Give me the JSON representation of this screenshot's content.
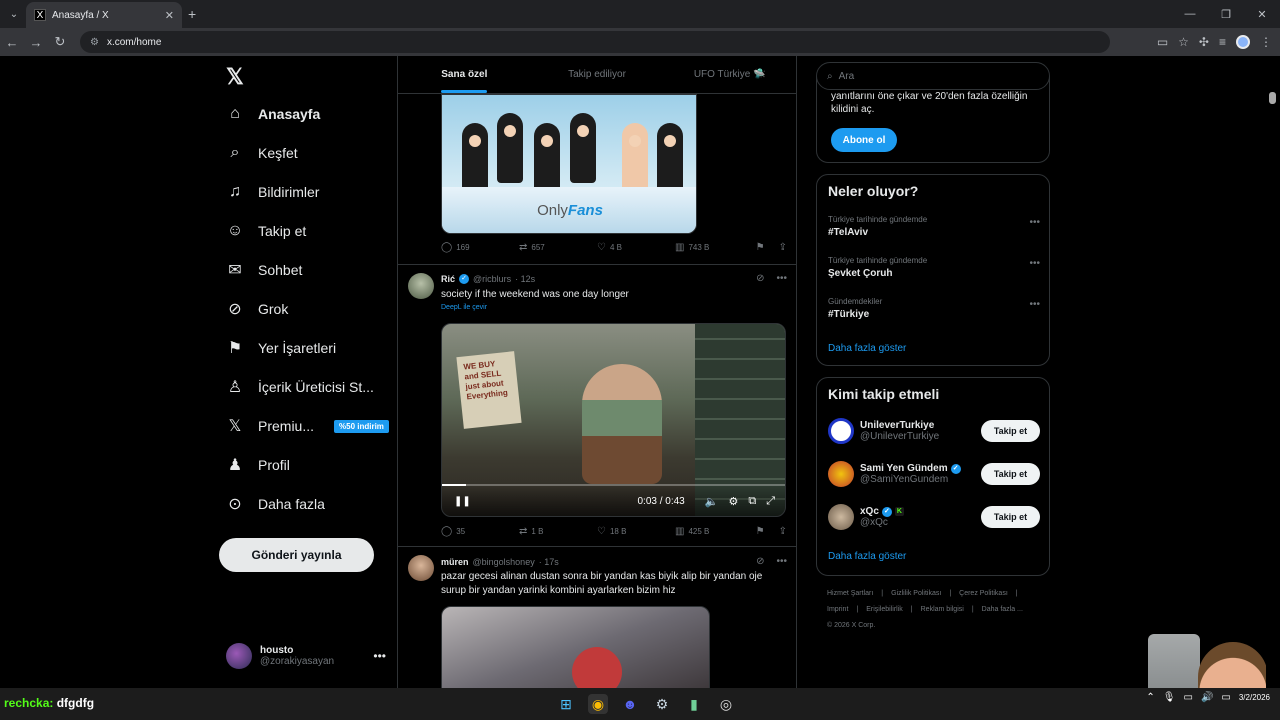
{
  "browser": {
    "tab_title": "Anasayfa / X",
    "tab_favicon": "X",
    "url": "x.com/home"
  },
  "nav": {
    "logo": "𝕏",
    "items": [
      {
        "label": "Anasayfa",
        "icon": "⌂"
      },
      {
        "label": "Keşfet",
        "icon": "⌕"
      },
      {
        "label": "Bildirimler",
        "icon": "♫"
      },
      {
        "label": "Takip et",
        "icon": "☺"
      },
      {
        "label": "Sohbet",
        "icon": "✉"
      },
      {
        "label": "Grok",
        "icon": "⊘"
      },
      {
        "label": "Yer İşaretleri",
        "icon": "⚑"
      },
      {
        "label": "İçerik Üreticisi St...",
        "icon": "♙"
      },
      {
        "label": "Premiu...",
        "icon": "𝕏"
      },
      {
        "label": "Profil",
        "icon": "♟"
      },
      {
        "label": "Daha fazla",
        "icon": "⊙"
      }
    ],
    "premium_badge": "%50 indirim",
    "post_button": "Gönderi yayınla",
    "user": {
      "name": "housto",
      "handle": "@zorakiyasayan",
      "more": "•••"
    }
  },
  "feed": {
    "tabs": [
      "Sana özel",
      "Takip ediliyor",
      "UFO Türkiye 🛸"
    ],
    "post1": {
      "image_caption": "Only",
      "image_caption_b": "Fans",
      "stats": {
        "replies": "169",
        "reposts": "657",
        "likes": "4 B",
        "views": "743 B"
      }
    },
    "post2": {
      "name": "Rić",
      "handle": "@ricblurs",
      "time": "· 12s",
      "text": "society if the weekend was one day longer",
      "translate": "DeepL ile çevir",
      "video_sign": "WE BUY and SELL just about Everything",
      "video_time": "0:03 / 0:43",
      "progress": 0.07,
      "stats": {
        "replies": "35",
        "reposts": "1 B",
        "likes": "18 B",
        "views": "425 B"
      }
    },
    "post3": {
      "name": "müren",
      "handle": "@bingolshoney",
      "time": "· 17s",
      "text": "pazar gecesi alinan dustan sonra bir yandan kas biyik alip bir yandan oje surup bir yandan yarinki kombini ayarlarken bizim hiz"
    }
  },
  "right": {
    "search_placeholder": "Ara",
    "premium_text": "yanıtlarını öne çıkar ve 20'den fazla özelliğin kilidini aç.",
    "abone_button": "Abone ol",
    "trends_title": "Neler oluyor?",
    "trends": [
      {
        "context": "Türkiye tarihinde gündemde",
        "title": "#TelAviv"
      },
      {
        "context": "Türkiye tarihinde gündemde",
        "title": "Şevket Çoruh"
      },
      {
        "context": "Gündemdekiler",
        "title": "#Türkiye"
      }
    ],
    "trends_more": "Daha fazla göster",
    "follow_title": "Kimi takip etmeli",
    "follow": [
      {
        "name": "UnileverTurkiye",
        "handle": "@UnileverTurkiye",
        "button": "Takip et"
      },
      {
        "name": "Sami Yen Gündem",
        "handle": "@SamiYenGundem",
        "button": "Takip et"
      },
      {
        "name": "xQc",
        "handle": "@xQc",
        "button": "Takip et"
      }
    ],
    "follow_more": "Daha fazla göster",
    "footer": [
      "Hizmet Şartları",
      "|",
      "Gizlilik Politikası",
      "|",
      "Çerez Politikası",
      "|",
      "Imprint",
      "|",
      "Erişilebilirlik",
      "|",
      "Reklam bilgisi",
      "|",
      "Daha fazla ...",
      "© 2026 X Corp."
    ]
  },
  "taskbar": {
    "overlay_label": "rechcka:",
    "overlay_value": "dfgdfg",
    "clock_time": "",
    "clock_date": "3/2/2026"
  },
  "colors": {
    "accent": "#1d9bf0",
    "bg": "#000000",
    "border": "#2f3336"
  }
}
